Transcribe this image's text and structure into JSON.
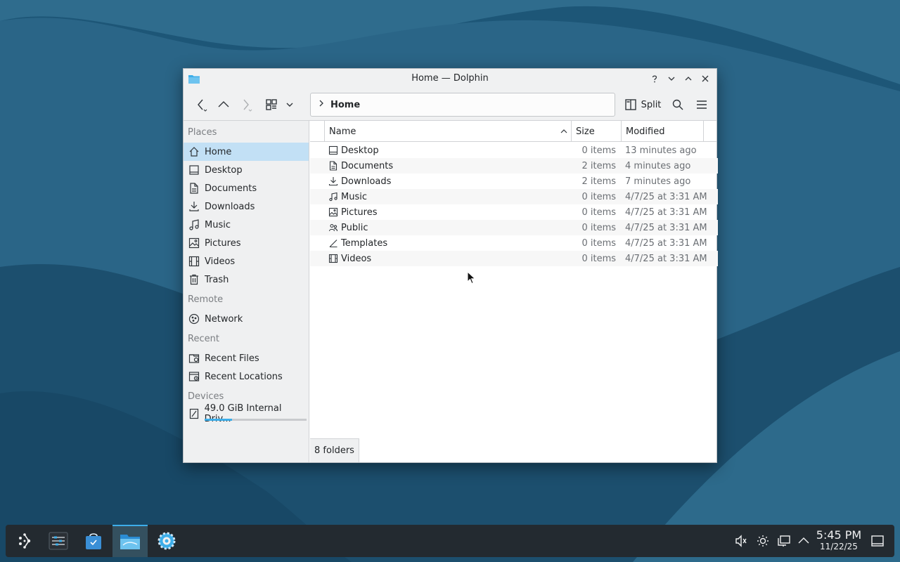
{
  "window": {
    "title": "Home — Dolphin",
    "controls": [
      "help-icon",
      "minimize-icon",
      "maximize-icon",
      "close-icon"
    ]
  },
  "toolbar": {
    "breadcrumb": "Home",
    "split_label": "Split"
  },
  "sidebar": {
    "sections": {
      "places": "Places",
      "remote": "Remote",
      "recent": "Recent",
      "devices": "Devices"
    },
    "places": [
      {
        "label": "Home",
        "icon": "home-icon",
        "active": true
      },
      {
        "label": "Desktop",
        "icon": "desktop-icon"
      },
      {
        "label": "Documents",
        "icon": "documents-icon"
      },
      {
        "label": "Downloads",
        "icon": "downloads-icon"
      },
      {
        "label": "Music",
        "icon": "music-icon"
      },
      {
        "label": "Pictures",
        "icon": "pictures-icon"
      },
      {
        "label": "Videos",
        "icon": "videos-icon"
      },
      {
        "label": "Trash",
        "icon": "trash-icon"
      }
    ],
    "remote": [
      {
        "label": "Network",
        "icon": "network-icon"
      }
    ],
    "recent": [
      {
        "label": "Recent Files",
        "icon": "recent-files-icon"
      },
      {
        "label": "Recent Locations",
        "icon": "recent-locations-icon"
      }
    ],
    "devices": [
      {
        "label": "49.0 GiB Internal Driv...",
        "icon": "drive-icon",
        "usage": 0.27
      }
    ]
  },
  "table": {
    "columns": {
      "name": "Name",
      "size": "Size",
      "modified": "Modified"
    },
    "rows": [
      {
        "name": "Desktop",
        "size": "0 items",
        "modified": "13 minutes ago"
      },
      {
        "name": "Documents",
        "size": "2 items",
        "modified": "4 minutes ago"
      },
      {
        "name": "Downloads",
        "size": "2 items",
        "modified": "7 minutes ago"
      },
      {
        "name": "Music",
        "size": "0 items",
        "modified": "4/7/25 at 3:31 AM"
      },
      {
        "name": "Pictures",
        "size": "0 items",
        "modified": "4/7/25 at 3:31 AM"
      },
      {
        "name": "Public",
        "size": "0 items",
        "modified": "4/7/25 at 3:31 AM"
      },
      {
        "name": "Templates",
        "size": "0 items",
        "modified": "4/7/25 at 3:31 AM"
      },
      {
        "name": "Videos",
        "size": "0 items",
        "modified": "4/7/25 at 3:31 AM"
      }
    ]
  },
  "status": {
    "text": "8 folders"
  },
  "taskbar": {
    "apps": [
      "application-launcher-icon",
      "system-monitor-icon",
      "discover-store-icon",
      "dolphin-file-manager-icon",
      "system-settings-icon"
    ],
    "clock": {
      "time": "5:45 PM",
      "date": "11/22/25"
    }
  },
  "colors": {
    "accent": "#3daee9",
    "selection": "#c2e0f5"
  }
}
